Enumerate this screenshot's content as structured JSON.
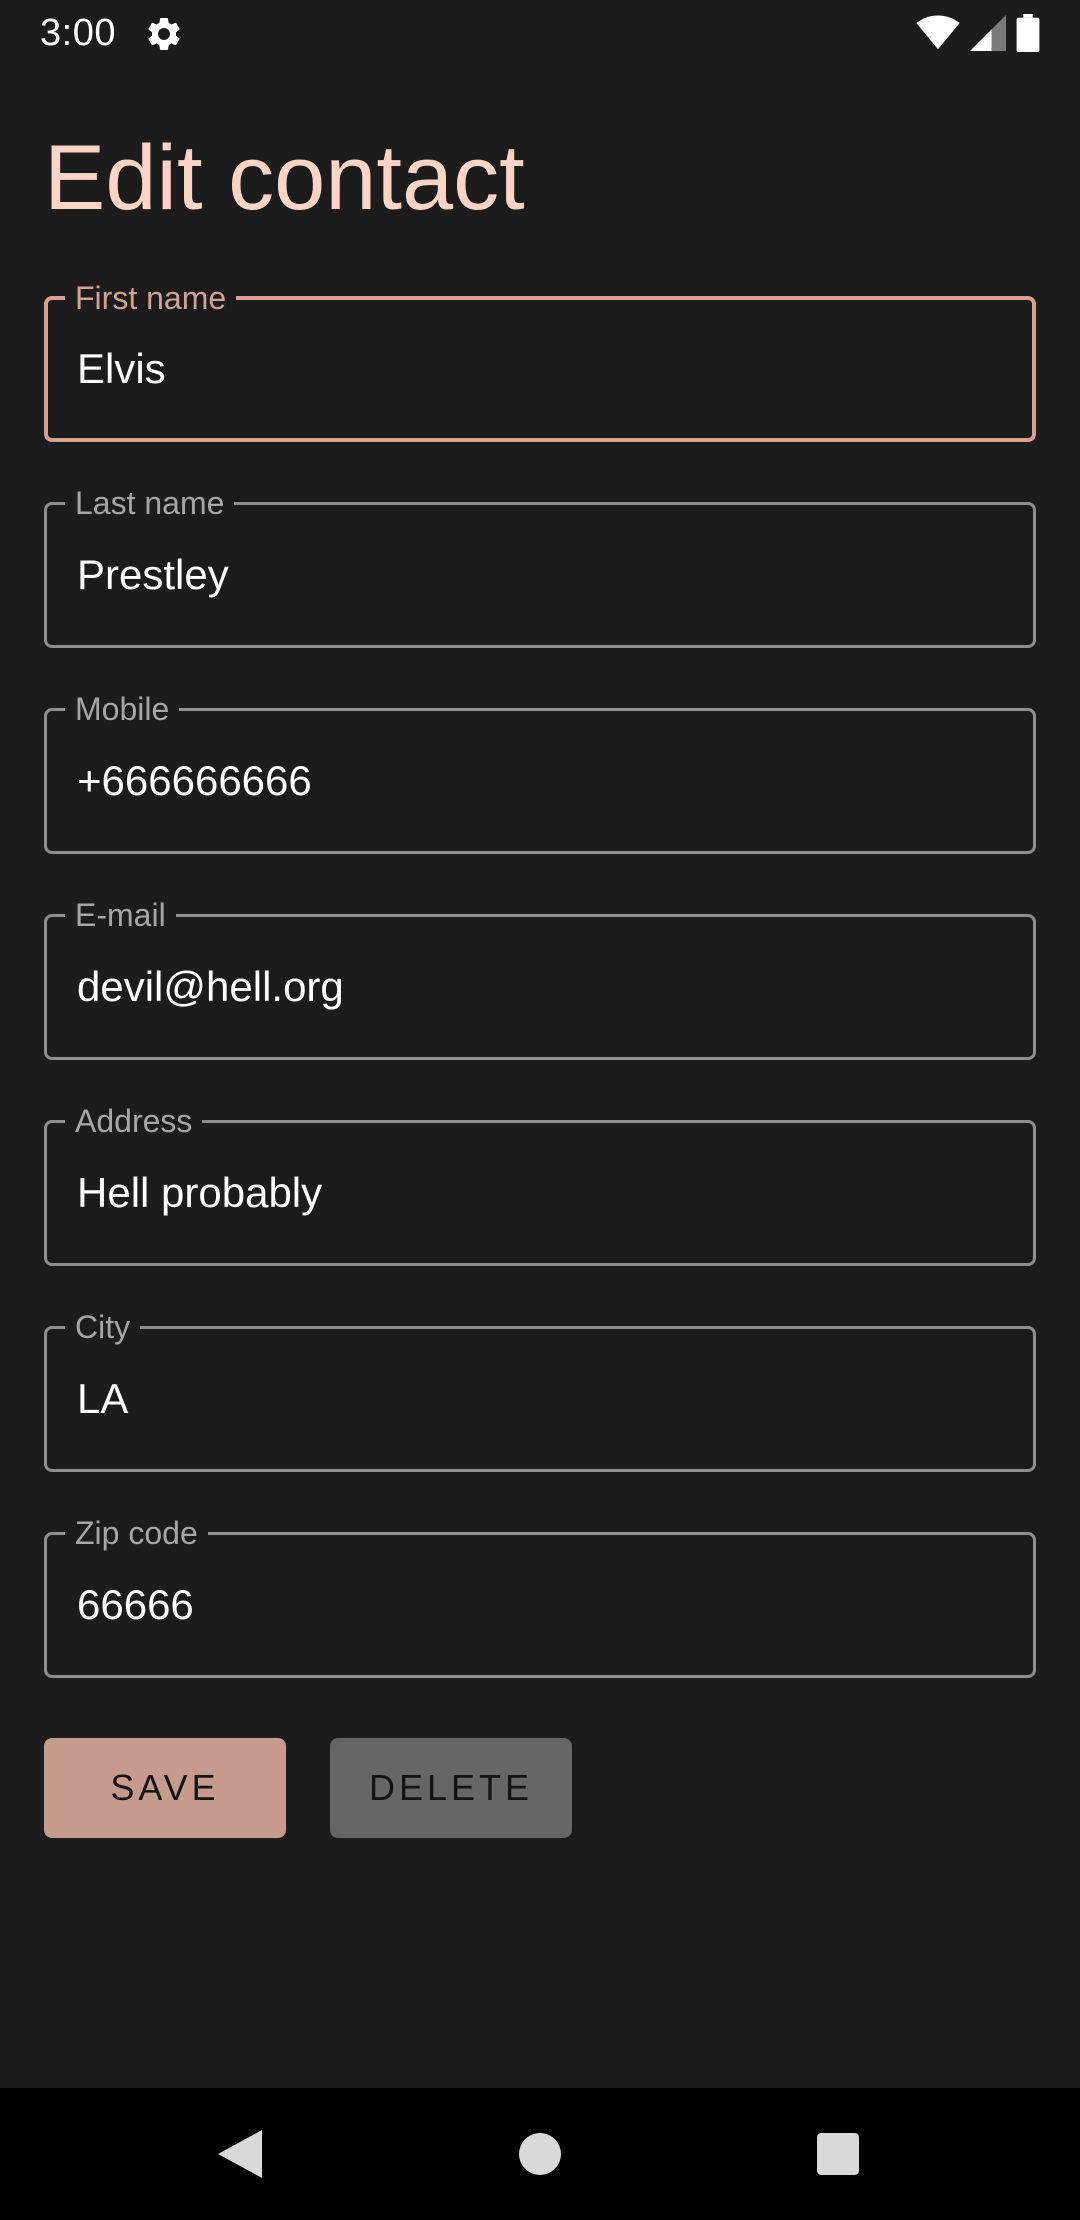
{
  "status_bar": {
    "time": "3:00",
    "icons": [
      "gear-icon",
      "wifi-icon",
      "signal-icon",
      "battery-icon"
    ]
  },
  "page": {
    "title": "Edit contact"
  },
  "form": {
    "fields": [
      {
        "label": "First name",
        "value": "Elvis",
        "focused": true
      },
      {
        "label": "Last name",
        "value": "Prestley"
      },
      {
        "label": "Mobile",
        "value": "+666666666"
      },
      {
        "label": "E-mail",
        "value": "devil@hell.org"
      },
      {
        "label": "Address",
        "value": "Hell probably"
      },
      {
        "label": "City",
        "value": "LA"
      },
      {
        "label": "Zip code",
        "value": "66666"
      }
    ]
  },
  "actions": {
    "save_label": "SAVE",
    "delete_label": "DELETE"
  },
  "nav_bar": {
    "icons": [
      "back-icon",
      "home-icon",
      "recents-icon"
    ]
  },
  "colors": {
    "background": "#1c1c1c",
    "accent": "#fdd4c6",
    "focused_outline": "#d99f8f",
    "save_button": "#c69a8d",
    "delete_button": "#666666"
  }
}
